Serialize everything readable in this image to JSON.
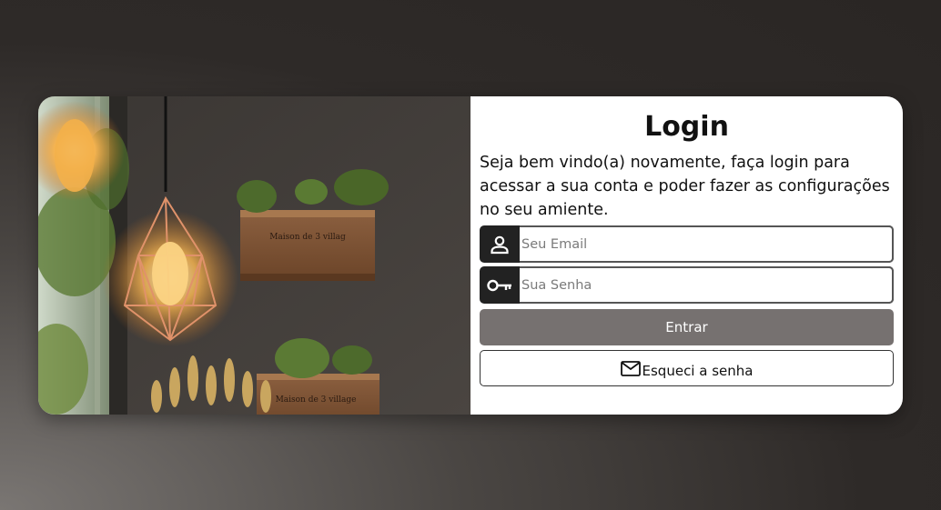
{
  "login": {
    "title": "Login",
    "welcome": "Seja bem vindo(a) novamente, faça login para acessar a sua conta e poder fazer as configurações no seu amiente.",
    "email": {
      "placeholder": "Seu Email",
      "icon": "user-icon"
    },
    "password": {
      "placeholder": "Sua Senha",
      "icon": "key-icon"
    },
    "submit_label": "Entrar",
    "forgot_label": "Esqueci a senha",
    "forgot_icon": "envelope-icon"
  },
  "photo": {
    "crate_text_top": "Maison de 3 villag",
    "crate_text_bottom": "Maison de 3 village"
  },
  "colors": {
    "submit_bg": "#767170",
    "icon_box_bg": "#222222",
    "card_bg": "#ffffff"
  }
}
